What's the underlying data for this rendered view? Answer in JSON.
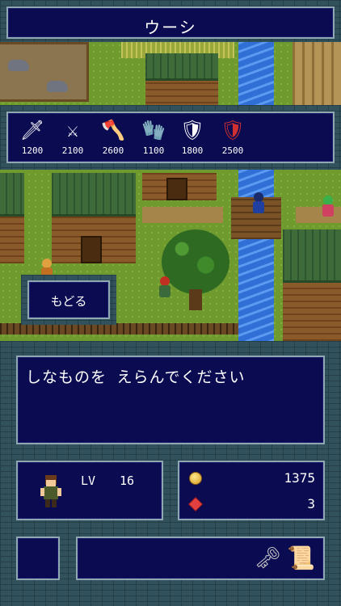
{
  "title": "ウーシ",
  "shop": {
    "items": [
      {
        "icon": "sword-icon",
        "glyph": "🗡",
        "price": "1200"
      },
      {
        "icon": "scimitar-icon",
        "glyph": "⚔",
        "price": "2100"
      },
      {
        "icon": "axe-icon",
        "glyph": "🪓",
        "price": "2600"
      },
      {
        "icon": "gauntlet-icon",
        "glyph": "🧤",
        "price": "1100"
      },
      {
        "icon": "armor-icon",
        "glyph": "🛡",
        "price": "1800"
      },
      {
        "icon": "red-shield-icon",
        "glyph": "🛡",
        "price": "2500"
      }
    ]
  },
  "back_button": {
    "label": "もどる"
  },
  "message": "しなものを えらんでください",
  "player": {
    "lv_label": "LV",
    "lv_value": "16"
  },
  "wallet": {
    "gold": "1375",
    "gems": "3"
  },
  "colors": {
    "panel": "#0b0b52",
    "border": "#8fa7b0",
    "frame": "#31525d"
  }
}
